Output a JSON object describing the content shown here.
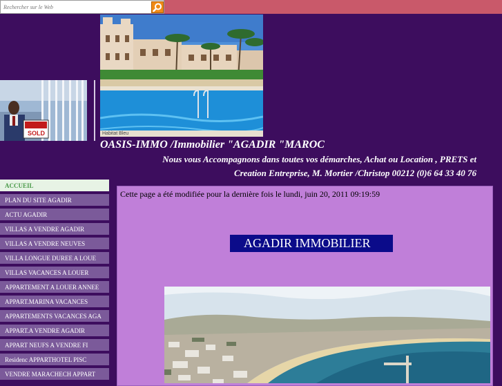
{
  "search": {
    "placeholder": "Rechercher sur le Web"
  },
  "header": {
    "photo_caption": "Habitat Bleu",
    "site_title": "OASIS-IMMO /Immobilier \"AGADIR \"MAROC",
    "tagline_line1": "Nous vous Accompagnons dans toutes vos démarches, Achat ou Location , PRETS et",
    "tagline_line2": "Creation Entreprise, M. Mortier /Christop 00212 (0)6 64 33 40 76",
    "sign_text": "SOLD"
  },
  "sidebar": {
    "items": [
      {
        "label": "ACCUEIL",
        "active": true
      },
      {
        "label": "PLAN DU SITE AGADIR"
      },
      {
        "label": "ACTU AGADIR"
      },
      {
        "label": "VILLAS A VENDRE AGADIR"
      },
      {
        "label": "VILLAS A VENDRE NEUVES"
      },
      {
        "label": "VILLA LONGUE DUREE A LOUE"
      },
      {
        "label": "VILLAS VACANCES A LOUER"
      },
      {
        "label": "APPARTEMENT A LOUER ANNEE"
      },
      {
        "label": "APPART.MARINA VACANCES"
      },
      {
        "label": "APPARTEMENTS VACANCES AGA"
      },
      {
        "label": "APPART.A VENDRE AGADIR"
      },
      {
        "label": "APPART NEUFS A VENDRE FI"
      },
      {
        "label": "Residenc APPARTHOTEL PISC"
      },
      {
        "label": "VENDRE MARACHECH APPART"
      }
    ]
  },
  "main": {
    "modified_text": "Cette page a été modifiée pour la dernière fois le lundi, juin 20, 2011 09:19:59",
    "title_box": "AGADIR  IMMOBILIER"
  },
  "colors": {
    "background": "#3d0d5e",
    "topbar": "#c9596a",
    "nav_item": "#7b5a9a",
    "nav_active": "#e7f3e5",
    "main_panel": "#c07fd9",
    "title_box": "#0b0b8a",
    "search_button": "#f08a16"
  }
}
